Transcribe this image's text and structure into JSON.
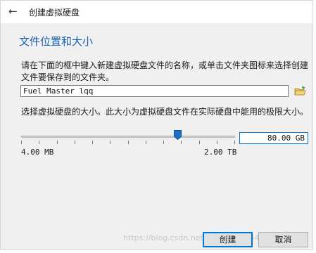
{
  "window": {
    "title": "创建虚拟硬盘"
  },
  "section": {
    "title": "文件位置和大小"
  },
  "location": {
    "description": "请在下面的框中键入新建虚拟硬盘文件的名称，或单击文件夹图标来选择创建文件要保存到的文件夹。",
    "file_name": "Fuel Master lqq"
  },
  "size": {
    "description": "选择虚拟硬盘的大小。此大小为虚拟硬盘文件在实际硬盘中能用的极限大小。",
    "value": "80.00 GB",
    "min_label": "4.00 MB",
    "max_label": "2.00 TB",
    "slider_fraction": 0.73
  },
  "buttons": {
    "create": "创建",
    "cancel": "取消"
  },
  "watermark": "https://blog.csdn.net/weixin_44444678",
  "icons": {
    "back": "back-arrow-icon",
    "folder": "folder-icon"
  },
  "colors": {
    "accent": "#1b5fb0",
    "focus": "#0078d7"
  }
}
